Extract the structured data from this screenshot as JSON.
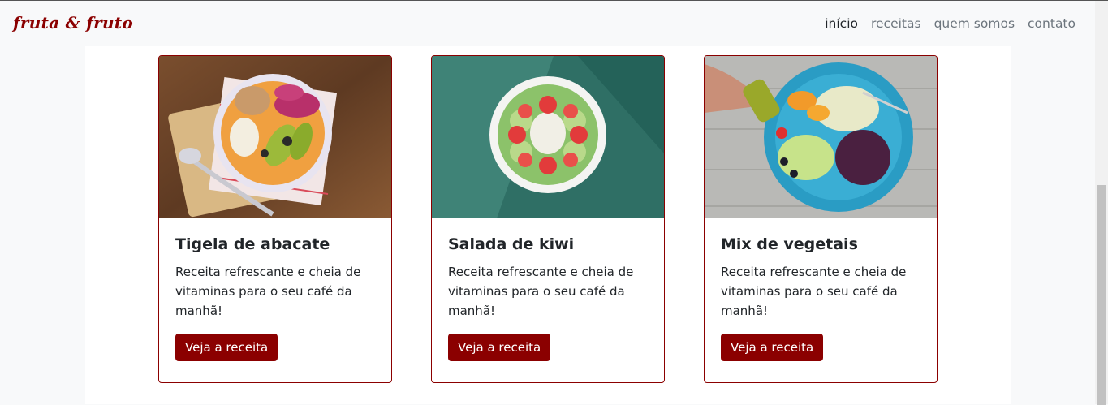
{
  "brand": "fruta & fruto",
  "nav": [
    {
      "label": "início",
      "active": true
    },
    {
      "label": "receitas",
      "active": false
    },
    {
      "label": "quem somos",
      "active": false
    },
    {
      "label": "contato",
      "active": false
    }
  ],
  "cards": [
    {
      "title": "Tigela de abacate",
      "text": "Receita refrescante e cheia de vitaminas para o seu café da manhã!",
      "button": "Veja a receita",
      "image": "acai-avocado-bowl-photo"
    },
    {
      "title": "Salada de kiwi",
      "text": "Receita refrescante e cheia de vitaminas para o seu café da manhã!",
      "button": "Veja a receita",
      "image": "kiwi-strawberry-bowl-photo"
    },
    {
      "title": "Mix de vegetais",
      "text": "Receita refrescante e cheia de vitaminas para o seu café da manhã!",
      "button": "Veja a receita",
      "image": "vegetable-salad-plate-photo"
    }
  ],
  "colors": {
    "accent": "#8b0000",
    "nav_muted": "#6c757d",
    "background": "#f8f9fa"
  }
}
